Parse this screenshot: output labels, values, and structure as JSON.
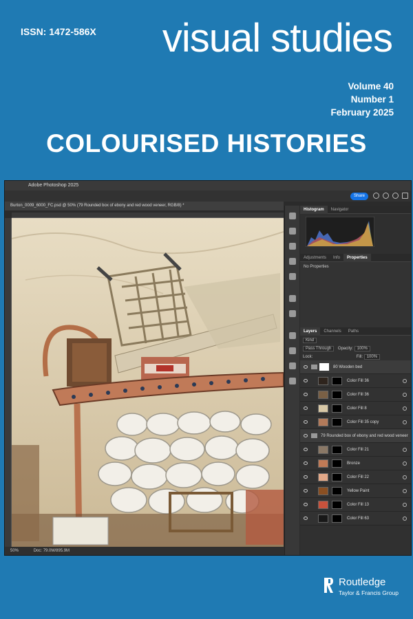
{
  "cover": {
    "issn": "ISSN: 1472-586X",
    "journal_title": "visual studies",
    "volume": "Volume 40",
    "number": "Number 1",
    "date": "February 2025",
    "headline": "COLOURISED HISTORIES",
    "publisher_name": "Routledge",
    "publisher_sub": "Taylor & Francis Group"
  },
  "photoshop": {
    "app_title": "Adobe Photoshop 2025",
    "share_label": "Share",
    "doc_tab": "Burton_0009_6000_FC.psd @ 50% (79 Rounded box of ebony and red wood veneer, RGB/8) *",
    "zoom": "50%",
    "doc_size": "Doc: 79.0M/895.9M",
    "panel_tabs_top": [
      "Histogram",
      "Navigator"
    ],
    "panel_tabs_mid": [
      "Adjustments",
      "Info",
      "Properties"
    ],
    "properties_text": "No Properties",
    "layer_tabs": [
      "Layers",
      "Channels",
      "Paths"
    ],
    "kind_label": "Kind",
    "blend_mode": "Pass Through",
    "opacity_label": "Opacity:",
    "opacity_value": "100%",
    "lock_label": "Lock:",
    "fill_label": "Fill:",
    "fill_value": "100%",
    "layers": [
      {
        "name": "80 Wooden bed",
        "color": "#ffffff",
        "group": true
      },
      {
        "name": "Color Fill 36",
        "color": "#2e241d",
        "group": false
      },
      {
        "name": "Color Fill 36",
        "color": "#7a6045",
        "group": false
      },
      {
        "name": "Color Fill 8",
        "color": "#d8c8a6",
        "group": false
      },
      {
        "name": "Color Fill 35 copy",
        "color": "#b27a5a",
        "group": false
      },
      {
        "name": "79 Rounded box of ebony and red wood veneer",
        "color": "#888888",
        "group": true
      },
      {
        "name": "Color Fill 21",
        "color": "#8a7866",
        "group": false
      },
      {
        "name": "Bronze",
        "color": "#c07a56",
        "group": false
      },
      {
        "name": "Color Fill 22",
        "color": "#e2a888",
        "group": false
      },
      {
        "name": "Yellow Paint",
        "color": "#8a4f22",
        "group": false
      },
      {
        "name": "Color Fill 13",
        "color": "#c8523c",
        "group": false
      },
      {
        "name": "Color Fill 63",
        "color": "#181818",
        "group": false
      }
    ]
  },
  "colors": {
    "cover_blue": "#1f7ab3",
    "ps_dark": "#2b2b2b",
    "accent_blue": "#1473e6"
  }
}
